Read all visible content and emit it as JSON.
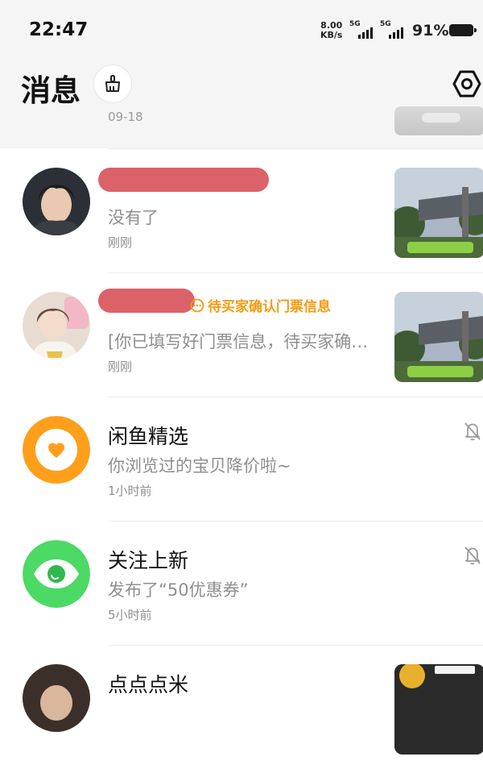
{
  "status_bar": {
    "time": "22:47",
    "net_speed_value": "8.00",
    "net_speed_unit": "KB/s",
    "sim1_label": "5G",
    "sim2_label": "5G",
    "battery": "91%"
  },
  "header": {
    "title": "消息",
    "clean_icon": "broom-icon",
    "settings_icon": "hexagon-settings-icon",
    "prev_row_date": "09-18"
  },
  "conversations": [
    {
      "type": "user",
      "name": "",
      "preview": "没有了",
      "time": "刚刚",
      "status": ""
    },
    {
      "type": "user",
      "name": "",
      "preview": "[你已填写好门票信息，待买家确认]",
      "time": "刚刚",
      "status": "待买家确认门票信息"
    },
    {
      "type": "system",
      "name": "闲鱼精选",
      "preview": "你浏览过的宝贝降价啦~",
      "time": "1小时前",
      "muted": true,
      "icon_color": "#ff9f1c"
    },
    {
      "type": "system",
      "name": "关注上新",
      "preview": "发布了“50优惠券”",
      "time": "5小时前",
      "muted": true,
      "icon_color": "#4cd964"
    },
    {
      "type": "user",
      "name": "点点点米",
      "preview": "",
      "time": ""
    }
  ]
}
